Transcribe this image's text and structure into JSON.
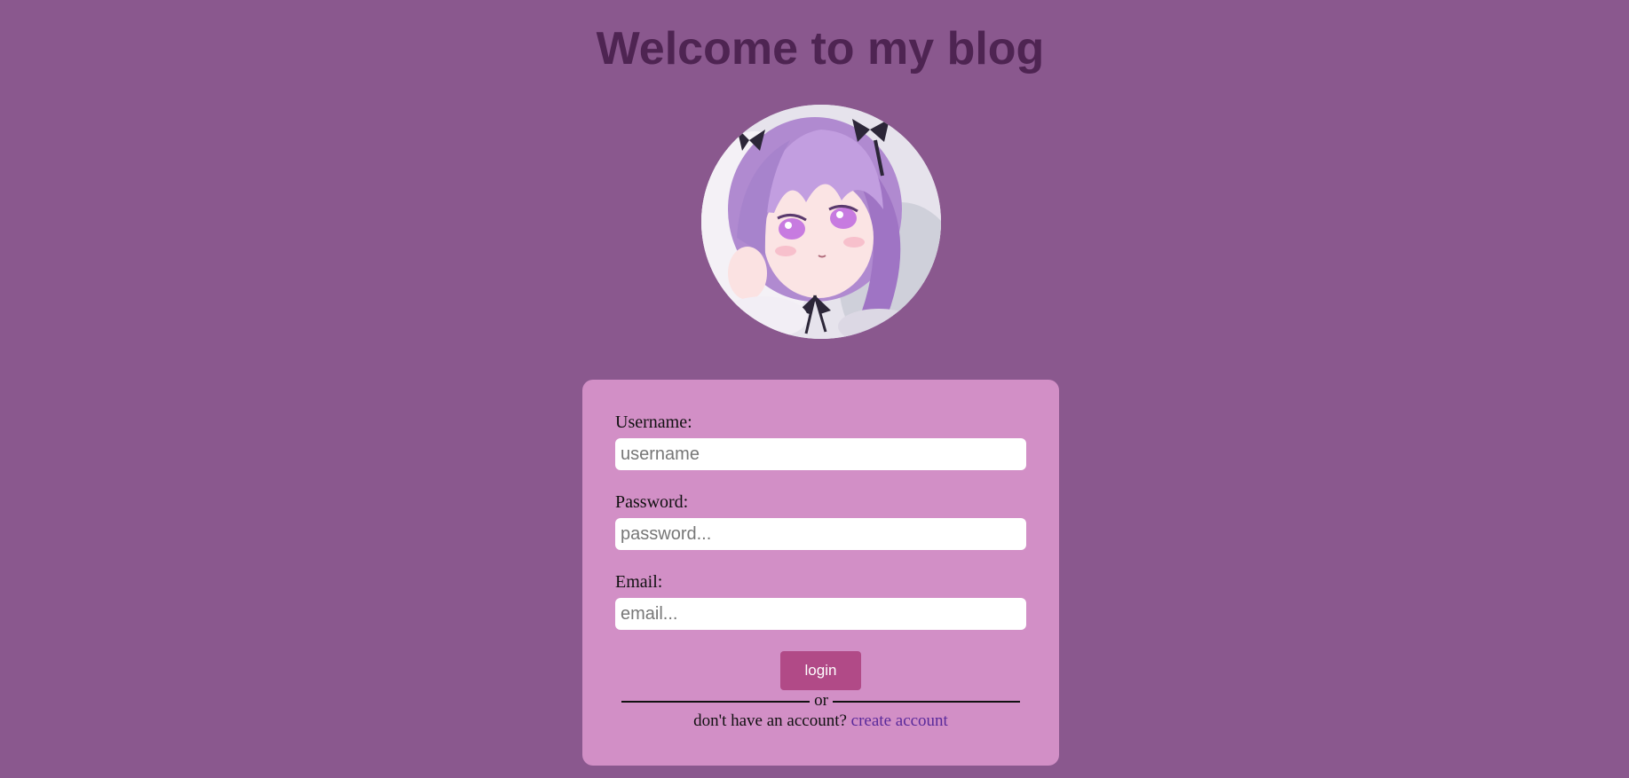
{
  "header": {
    "title": "Welcome to my blog"
  },
  "avatar": {
    "icon": "avatar-anime-girl-illustration"
  },
  "login_form": {
    "username": {
      "label": "Username:",
      "value": "",
      "placeholder": "username"
    },
    "password": {
      "label": "Password:",
      "value": "",
      "placeholder": "password..."
    },
    "email": {
      "label": "Email:",
      "value": "",
      "placeholder": "email..."
    },
    "login_label": "login",
    "divider_text": "or",
    "signup_prompt": "don't have an account?",
    "signup_link": "create account"
  },
  "colors": {
    "background": "#8a588e",
    "title": "#4e2452",
    "card": "#d28fc6",
    "button": "#b14a87",
    "link": "#5a2a9b"
  }
}
